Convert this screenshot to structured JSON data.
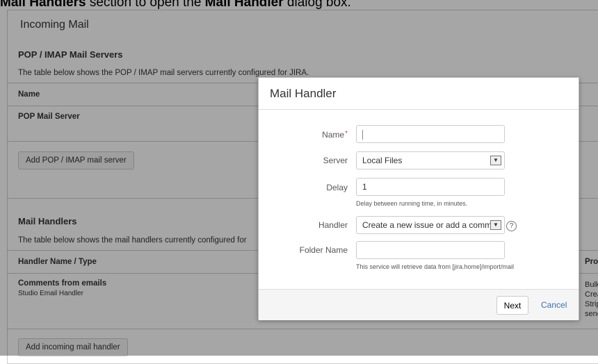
{
  "caption": {
    "pre": "",
    "bold1": "Mail Handlers",
    "mid": " section to open the ",
    "bold2": "Mail Handler",
    "post": " dialog box."
  },
  "page": {
    "title": "Incoming Mail",
    "pop": {
      "title": "POP / IMAP Mail Servers",
      "desc": "The table below shows the POP / IMAP mail servers currently configured for JIRA.",
      "col_name": "Name",
      "row_name": "POP Mail Server",
      "add_button": "Add POP / IMAP mail server"
    },
    "handlers": {
      "title": "Mail Handlers",
      "desc": "The table below shows the mail handlers currently configured for",
      "col_name": "Handler Name / Type",
      "col_pro": "Pro",
      "row_name": "Comments from emails",
      "row_type": "Studio Email Handler",
      "row_props": [
        "Bulk",
        "Crea",
        "Strip",
        "send"
      ],
      "add_button": "Add incoming mail handler"
    }
  },
  "dialog": {
    "title": "Mail Handler",
    "name_label": "Name",
    "name_value": "",
    "server_label": "Server",
    "server_value": "Local Files",
    "delay_label": "Delay",
    "delay_value": "1",
    "delay_hint": "Delay between running time, in minutes.",
    "handler_label": "Handler",
    "handler_value": "Create a new issue or add a comm",
    "folder_label": "Folder Name",
    "folder_value": "",
    "folder_hint": "This service will retrieve data from [jira.home]/import/mail",
    "next": "Next",
    "cancel": "Cancel"
  }
}
